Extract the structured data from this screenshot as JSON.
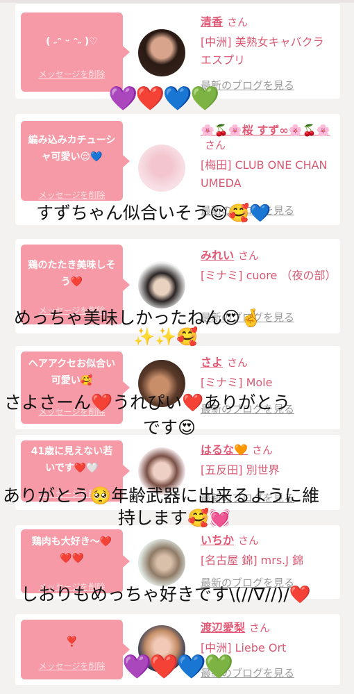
{
  "cards": [
    {
      "bubble": "( ˶ᵔ ᵕ ᵔ˶ )♡",
      "delete_label": "メッセージを削除",
      "name": "清香",
      "san": "さん",
      "shop": "[中洲] 美熟女キャバクラ エスプリ",
      "blog": "最新のブログを見る"
    },
    {
      "bubble": "編み込みカチューシャ可愛い😌💙",
      "delete_label": "メッセージを削除",
      "name": "🌸🍒🌸桜 すず∞🌸🍒🌸",
      "san": "さん",
      "shop": "[梅田] CLUB ONE CHAN UMEDA",
      "blog": "最新のブログを見る"
    },
    {
      "bubble": "鶏のたたき美味しそう❤️",
      "delete_label": "メッセージを削除",
      "name": "みれい",
      "san": "さん",
      "shop": "[ミナミ] cuore （夜の部）",
      "blog": "最新のブログを見る"
    },
    {
      "bubble": "ヘアアクセお似合い可愛い🥰",
      "delete_label": "メッセージを削除",
      "name": "さよ",
      "san": "さん",
      "shop": "[ミナミ] Mole",
      "blog": "最新のブログを見る"
    },
    {
      "bubble": "41歳に見えない若いです❤️🤍",
      "delete_label": "メッセージを削除",
      "name": "はるな🧡",
      "san": "さん",
      "shop": "[五反田] 別世界",
      "blog": "最新のブログを見る"
    },
    {
      "bubble": "鶏肉も大好き〜❤️❤️❤️",
      "delete_label": "メッセージを削除",
      "name": "いちか",
      "san": "さん",
      "shop": "[名古屋 錦] mrs.J 錦",
      "blog": "最新のブログを見る"
    },
    {
      "bubble": "❣️",
      "delete_label": "メッセージを削除",
      "name": "渡辺愛梨",
      "san": "さん",
      "shop": "[中洲] Liebe Ort",
      "blog": "最新のブログを見る"
    }
  ],
  "overlays": {
    "hearts_top": "💜❤️💙💚",
    "line1": "すずちゃん似合いそう😌🥰💙",
    "line2": "めっちゃ美味しかったねん😍🤞",
    "line2b": "✨✨🥰",
    "line3": "さよさーん❤️うれぴい❤️ありがとう",
    "line3b": "です😍",
    "line4": "ありがとう🥺年齢武器に出来るように維",
    "line4b": "持します🥰💓",
    "line5": "しおりもめっちゃ好きです\\(//∇//)/❤️",
    "hearts_bottom": "💜❤️💙💚"
  },
  "colors": {
    "bubble": "#f59aa6",
    "name": "#e05a78",
    "background": "#f4f1f1"
  }
}
